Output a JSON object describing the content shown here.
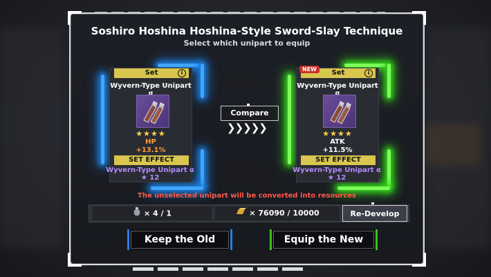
{
  "dialog": {
    "title": "Soshiro Hoshina Hoshina-Style Sword-Slay Technique",
    "subtitle": "Select which unipart to equip"
  },
  "cards": [
    {
      "set_label": "Set",
      "info_icon": "info-icon",
      "name": "Wyvern-Type Unipart α",
      "stars": "★★★★",
      "stat_name": "HP",
      "stat_value": "+13.1%",
      "set_effect_label": "SET EFFECT",
      "set_name": "Wyvern-Type Unipart α ★ 12",
      "stat_color": "#ff9f3a",
      "glow": "#3fa6ff"
    },
    {
      "badge": "NEW",
      "set_label": "Set",
      "info_icon": "info-icon",
      "name": "Wyvern-Type Unipart α",
      "stars": "★★★★",
      "stat_name": "ATK",
      "stat_value": "+11.5%",
      "set_effect_label": "SET EFFECT",
      "set_name": "Wyvern-Type Unipart α ★ 12",
      "stat_color": "#ffffff",
      "glow": "#7dff5a"
    }
  ],
  "compare": {
    "label": "Compare",
    "arrows": "❯❯❯❯❯"
  },
  "warning": "The unselected unipart will be converted into resources",
  "resources": {
    "item1": {
      "icon": "grenade-icon",
      "text": "× 4 / 1"
    },
    "item2": {
      "icon": "gold-bar-icon",
      "text": "× 76090 / 10000"
    },
    "redevelop_label": "Re-Develop"
  },
  "buttons": {
    "keep_old": "Keep the Old",
    "equip_new": "Equip the New"
  }
}
